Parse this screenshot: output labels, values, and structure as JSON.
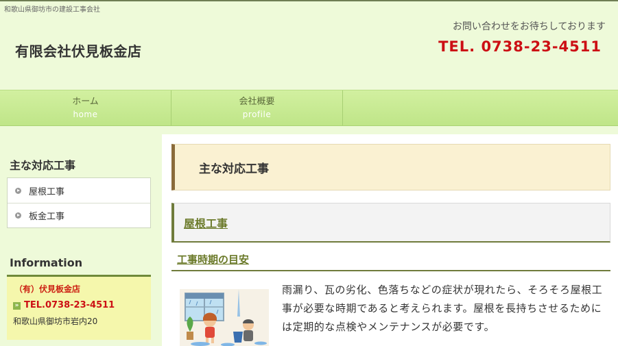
{
  "header": {
    "tagline": "和歌山県御坊市の建設工事会社",
    "site_title": "有限会社伏見板金店",
    "contact_message": "お問い合わせをお待ちしております",
    "tel": "TEL. 0738-23-4511"
  },
  "gnav": {
    "items": [
      {
        "label": "ホーム",
        "sub": "home"
      },
      {
        "label": "会社概要",
        "sub": "profile"
      }
    ]
  },
  "sidebar": {
    "heading": "主な対応工事",
    "items": [
      {
        "label": "屋根工事"
      },
      {
        "label": "板金工事"
      }
    ],
    "info_heading": "Information",
    "info": {
      "company": "（有）伏見板金店",
      "tel_icon": "»",
      "tel": "TEL.0738-23-4511",
      "address": "和歌山県御坊市岩内20"
    }
  },
  "main": {
    "heading": "主な対応工事",
    "section_title": "屋根工事",
    "sub_title": "工事時期の目安",
    "body": "雨漏り、瓦の劣化、色落ちなどの症状が現れたら、そろそろ屋根工事が必要な時期であると考えられます。屋根を長持ちさせるためには定期的な点検やメンテナンスが必要です。"
  },
  "colors": {
    "accent_red": "#cc0f14",
    "nav_green": "#c7ea92",
    "page_bg": "#eefad9",
    "olive": "#6b7a2a"
  }
}
